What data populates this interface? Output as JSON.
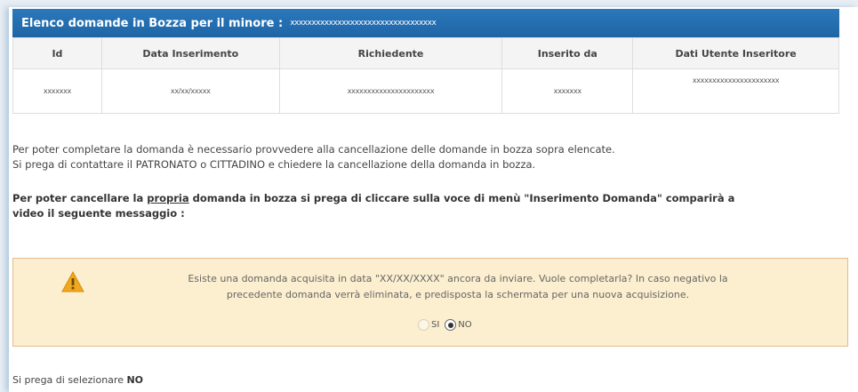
{
  "panel": {
    "title": "Elenco domande in Bozza per il minore :",
    "minor_masked": "xxxxxxxxxxxxxxxxxxxxxxxxxxxxxxxxxx"
  },
  "table": {
    "headers": [
      "Id",
      "Data Inserimento",
      "Richiedente",
      "Inserito da",
      "Dati Utente Inseritore"
    ],
    "rows": [
      [
        "xxxxxxx",
        "xx/xx/xxxxx",
        "xxxxxxxxxxxxxxxxxxxxxx",
        "xxxxxxx",
        "xxxxxxxxxxxxxxxxxxxxxx"
      ]
    ]
  },
  "info": {
    "line1": "Per poter completare la domanda è necessario provvedere alla cancellazione delle domande in bozza sopra elencate.",
    "line2": "Si prega di contattare il PATRONATO o CITTADINO e chiedere la cancellazione della domanda in bozza."
  },
  "instruction": {
    "part1": "Per poter cancellare la ",
    "underlined": "propria",
    "part2": " domanda in bozza si prega di cliccare sulla voce di menù \"Inserimento Domanda\" comparirà a",
    "line2": "video il seguente messaggio :"
  },
  "alert": {
    "icon": "warning-icon",
    "line1": "Esiste una domanda acquisita in data \"XX/XX/XXXX\" ancora da inviare. Vuole completarla? In caso negativo la",
    "line2": "precedente domanda verrà eliminata, e predisposta la schermata per una nuova acquisizione.",
    "option_si": "SI",
    "option_no": "NO",
    "selected": "NO"
  },
  "footer": {
    "prefix": "Si prega di selezionare ",
    "emphasis": "NO"
  }
}
